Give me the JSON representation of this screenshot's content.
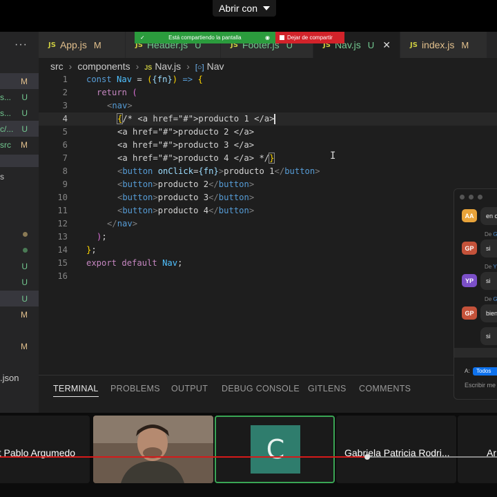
{
  "topbar": {
    "open_with": "Abrir con"
  },
  "share_banner": {
    "sharing_text": "Está compartiendo la pantalla",
    "stop_text": "Dejar de compartir"
  },
  "tabs": [
    {
      "icon": "JS",
      "label": "App.js",
      "status": "M"
    },
    {
      "icon": "JS",
      "label": "Header.js",
      "status": "U"
    },
    {
      "icon": "JS",
      "label": "Footer.js",
      "status": "U"
    },
    {
      "icon": "JS",
      "label": "Nav.js",
      "status": "U",
      "close": "✕"
    },
    {
      "icon": "JS",
      "label": "index.js",
      "status": "M"
    }
  ],
  "tab_more": "···",
  "sidebar": {
    "items": [
      {
        "name": "",
        "status": "M"
      },
      {
        "name": "s...",
        "status": "U"
      },
      {
        "name": "s...",
        "status": "U"
      },
      {
        "name": "c/...",
        "status": "U"
      },
      {
        "name": "src",
        "status": "M"
      },
      {
        "name": "s",
        "status": ""
      },
      {
        "name": "",
        "status": "U"
      },
      {
        "name": "",
        "status": "U"
      },
      {
        "name": "",
        "status": "U"
      },
      {
        "name": "",
        "status": "M"
      },
      {
        "name": "",
        "status": "M"
      },
      {
        "name": ".json",
        "status": ""
      }
    ]
  },
  "breadcrumb": {
    "part1": "src",
    "part2": "components",
    "file_icon": "JS",
    "file": "Nav.js",
    "symbol": "Nav"
  },
  "code_lines": [
    "1",
    "2",
    "3",
    "4",
    "5",
    "6",
    "7",
    "8",
    "9",
    "10",
    "11",
    "12",
    "13",
    "14",
    "15",
    "16"
  ],
  "code": {
    "l1": {
      "a": "const ",
      "b": "Nav",
      "c": " = ",
      "d": "(",
      "e": "{fn}",
      "f": ")",
      "g": " => ",
      "h": "{"
    },
    "l2": {
      "a": "return ",
      "b": "("
    },
    "l3": {
      "a": "<",
      "b": "nav",
      "c": ">"
    },
    "l4": {
      "a": "{",
      "b": "/* <a href=\"#\">producto 1 </a>"
    },
    "l5": "<a href=\"#\">producto 2 </a>",
    "l6": "<a href=\"#\">producto 3 </a>",
    "l7": {
      "a": "<a href=\"#\">producto 4 </a> */",
      "b": "}"
    },
    "l8": {
      "a": "<",
      "b": "button",
      "c": " onClick",
      "d": "=",
      "e": "{fn}",
      "f": ">",
      "g": "producto 1",
      "h": "</",
      "i": "button",
      "j": ">"
    },
    "l9": {
      "a": "<",
      "b": "button",
      "c": ">",
      "d": "producto 2",
      "e": "</",
      "f": "button",
      "g": ">"
    },
    "l10": {
      "a": "<",
      "b": "button",
      "c": ">",
      "d": "producto 3",
      "e": "</",
      "f": "button",
      "g": ">"
    },
    "l11": {
      "a": "<",
      "b": "button",
      "c": ">",
      "d": "producto 4",
      "e": "</",
      "f": "button",
      "g": ">"
    },
    "l12": {
      "a": "</",
      "b": "nav",
      "c": ">"
    },
    "l13": {
      "a": ")",
      "b": ";"
    },
    "l14": {
      "a": "}",
      "b": ";"
    },
    "l15": {
      "a": "export ",
      "b": "default ",
      "c": "Nav",
      "d": ";"
    }
  },
  "panel_tabs": [
    "TERMINAL",
    "PROBLEMS",
    "OUTPUT",
    "DEBUG CONSOLE",
    "GITLENS",
    "COMMENTS"
  ],
  "chat": {
    "messages": [
      {
        "initials": "AA",
        "color": "#e8a33a",
        "from": "",
        "text": "en c"
      },
      {
        "initials": "GP",
        "color": "#c4523a",
        "from": "G",
        "text": "si"
      },
      {
        "initials": "YP",
        "color": "#7b4fc8",
        "from": "Y",
        "text": "si"
      },
      {
        "initials": "GP",
        "color": "#c4523a",
        "from": "G",
        "text": "bien"
      },
      {
        "initials": "",
        "color": "",
        "from": "",
        "text": "si"
      }
    ],
    "from_prefix": "De",
    "to_label": "A:",
    "to_value": "Todos",
    "input_placeholder": "Escribir me"
  },
  "participants": [
    {
      "name": "rit Pablo Argumedo"
    },
    {
      "name": ""
    },
    {
      "name": "",
      "avatar_letter": "C"
    },
    {
      "name": "Gabriela Patricia Rodri..."
    },
    {
      "name": "Ar"
    }
  ],
  "video_progress": 0.736,
  "colors": {
    "accent_green": "#2b9c3d",
    "stop_red": "#d2232a",
    "progress_red": "#d61a1a"
  }
}
